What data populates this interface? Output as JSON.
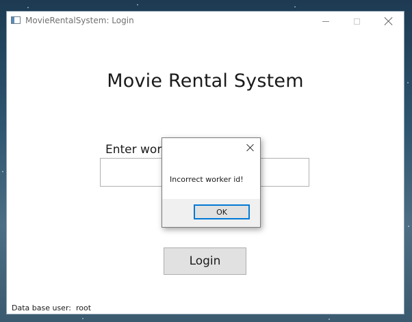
{
  "window": {
    "title": "MovieRentalSystem: Login"
  },
  "main": {
    "heading": "Movie Rental System",
    "worker_label": "Enter worker id:",
    "worker_input_value": "",
    "login_label": "Login",
    "db_user_text": "Data base user:  root"
  },
  "dialog": {
    "message": "Incorrect worker id!",
    "ok_label": "OK"
  },
  "icons": {
    "app": "window-app-icon",
    "minimize": "minimize-icon",
    "maximize": "maximize-icon",
    "close": "close-icon"
  },
  "colors": {
    "window_bg": "#ffffff",
    "button_bg": "#e1e1e1",
    "dialog_footer_bg": "#f0f0f0",
    "focus_border": "#0078d7"
  }
}
